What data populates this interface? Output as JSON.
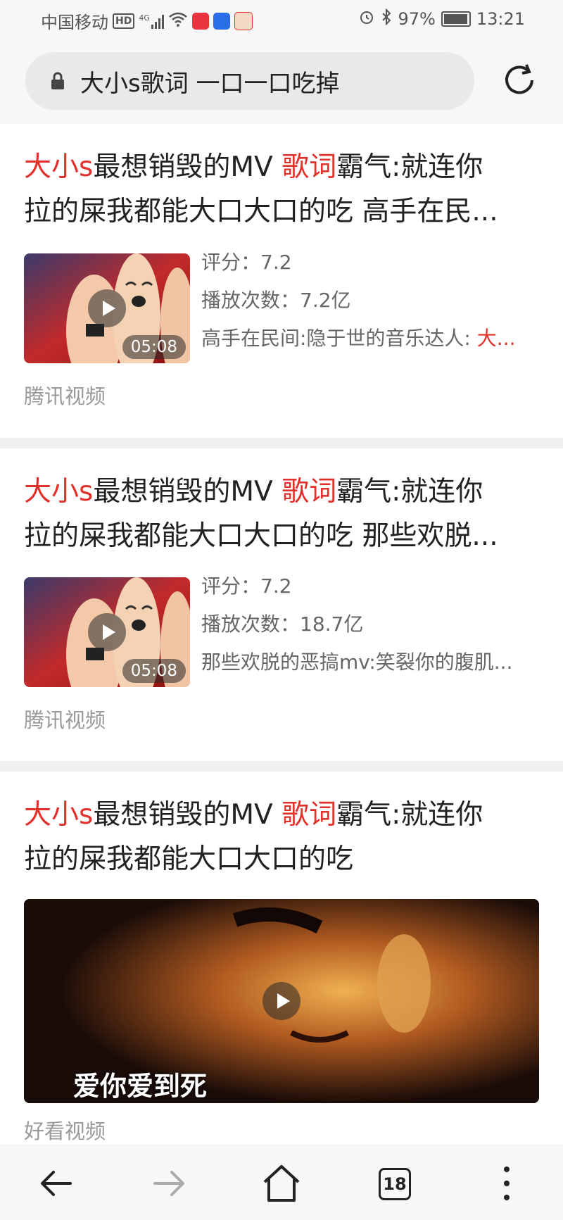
{
  "status": {
    "carrier": "中国移动",
    "hd": "HD",
    "network": "4G",
    "battery": "97%",
    "battery_level": 0.97,
    "time": "13:21"
  },
  "search": {
    "query": "大小s歌词  一口一口吃掉"
  },
  "results": [
    {
      "title_hl1": "大小s",
      "title_mid": "最想销毁的MV ",
      "title_hl2": "歌词",
      "title_rest": "霸气:就连你",
      "title_line2": "拉的屎我都能大口大口的吃 高手在民...",
      "rating": "评分：7.2",
      "plays": "播放次数：7.2亿",
      "desc": "高手在民间:隐于世的音乐达人: ",
      "desc_hl": "大...",
      "duration": "05:08",
      "source": "腾讯视频"
    },
    {
      "title_hl1": "大小s",
      "title_mid": "最想销毁的MV ",
      "title_hl2": "歌词",
      "title_rest": "霸气:就连你",
      "title_line2": "拉的屎我都能大口大口的吃 那些欢脱...",
      "rating": "评分：7.2",
      "plays": "播放次数：18.7亿",
      "desc": "那些欢脱的恶搞mv:笑裂你的腹肌...",
      "duration": "05:08",
      "source": "腾讯视频"
    },
    {
      "title_hl1": "大小s",
      "title_mid": "最想销毁的MV ",
      "title_hl2": "歌词",
      "title_rest": "霸气:就连你",
      "title_line2": "拉的屎我都能大口大口的吃",
      "caption": "爱你爱到死",
      "source": "好看视频"
    }
  ],
  "nav": {
    "tab_count": "18"
  },
  "colors": {
    "highlight": "#e2312b",
    "background": "#f0f0f2"
  }
}
